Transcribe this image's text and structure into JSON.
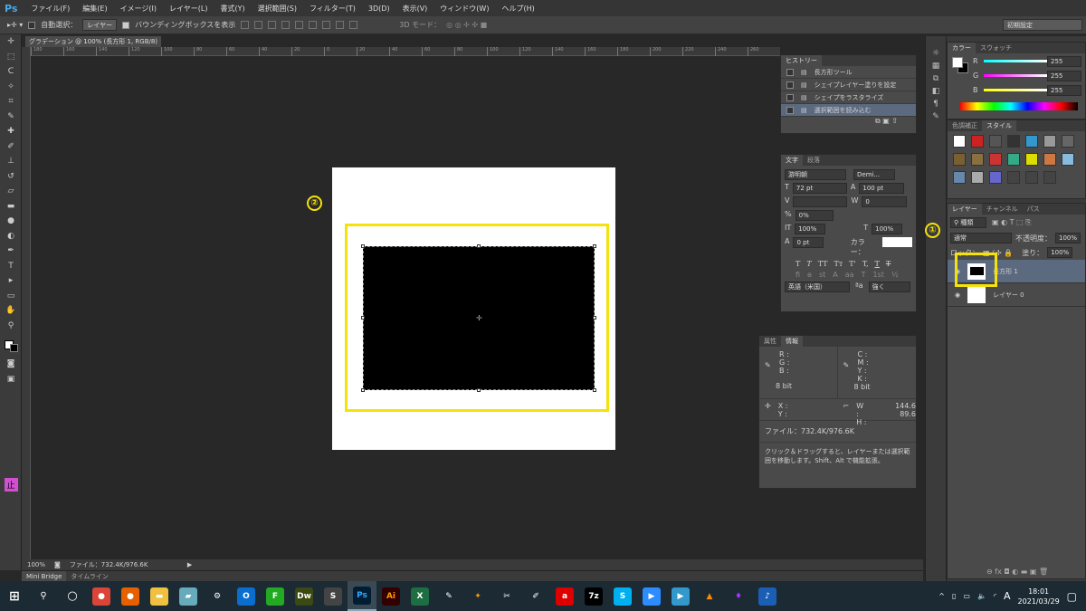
{
  "app": {
    "logo": "Ps",
    "workspace": "初期設定"
  },
  "menu": [
    "ファイル(F)",
    "編集(E)",
    "イメージ(I)",
    "レイヤー(L)",
    "書式(Y)",
    "選択範囲(S)",
    "フィルター(T)",
    "3D(D)",
    "表示(V)",
    "ウィンドウ(W)",
    "ヘルプ(H)"
  ],
  "options": {
    "auto_select": "自動選択：",
    "target": "レイヤー",
    "bounding_box": "バウンディングボックスを表示",
    "mode3d": "3D モード："
  },
  "document": {
    "tab_title": "グラデーション @ 100% (長方形 1, RGB/8) *",
    "ruler_ticks": [
      "180",
      "160",
      "140",
      "120",
      "100",
      "80",
      "60",
      "40",
      "20",
      "0",
      "20",
      "40",
      "60",
      "80",
      "100",
      "120",
      "140",
      "160",
      "180",
      "200",
      "220",
      "240",
      "260"
    ]
  },
  "annotations": {
    "one": "①",
    "two": "②",
    "color": "#f5e20a"
  },
  "history": {
    "tab": "ヒストリー",
    "items": [
      "長方形ツール",
      "シェイプレイヤー塗りを設定",
      "シェイプをラスタライズ",
      "選択範囲を読み込む"
    ],
    "selected": 3
  },
  "character": {
    "tabs": [
      "文字",
      "段落"
    ],
    "font": "游明朝",
    "style": "Demi...",
    "size": "72 pt",
    "leading": "100 pt",
    "kerning": "",
    "tracking": "0",
    "tsume": "0%",
    "vscale": "100%",
    "hscale": "100%",
    "baseline": "0 pt",
    "color_label": "カラー：",
    "language": "英語（米国）",
    "antialias": "強く",
    "aa_label": "ªa"
  },
  "info": {
    "tabs": [
      "属性",
      "情報"
    ],
    "rgb": [
      "R :",
      "G :",
      "B :"
    ],
    "cmyk": [
      "C :",
      "M :",
      "Y :",
      "K :"
    ],
    "bit_left": "8 bit",
    "bit_right": "8 bit",
    "xy": [
      "X :",
      "Y :"
    ],
    "w_label": "W :",
    "h_label": "H :",
    "w": "144.6",
    "h": "89.6",
    "file": "ファイル：732.4K/976.6K",
    "hint": "クリック＆ドラッグすると、レイヤーまたは選択範囲を移動します。Shift、Alt で機能拡張。"
  },
  "color": {
    "tabs": [
      "カラー",
      "スウォッチ"
    ],
    "r": "255",
    "g": "255",
    "b": "255",
    "labels": [
      "R",
      "G",
      "B"
    ]
  },
  "styles": {
    "tabs": [
      "色調補正",
      "スタイル"
    ]
  },
  "layers": {
    "tabs": [
      "レイヤー",
      "チャンネル",
      "パス"
    ],
    "filter": "種類",
    "blend": "通常",
    "opacity_label": "不透明度：",
    "opacity": "100%",
    "lock_label": "ロック：",
    "fill_label": "塗り：",
    "fill": "100%",
    "items": [
      {
        "name": "長方形 1",
        "selected": true
      },
      {
        "name": "レイヤー 0",
        "selected": false
      }
    ]
  },
  "status": {
    "zoom": "100%",
    "file": "ファイル：732.4K/976.6K"
  },
  "bottom_tabs": [
    "Mini Bridge",
    "タイムライン"
  ],
  "taskbar": {
    "apps": [
      "Chrome",
      "Firefox",
      "Explorer",
      "Notes",
      "Settings",
      "Outlook",
      "FTP",
      "Dw",
      "Sublime",
      "Ps",
      "Ai",
      "X",
      "Tool",
      "Butterfly",
      "Paint",
      "Palette",
      "Acrobat",
      "7z",
      "S",
      "Zoom",
      "Player",
      "VLC",
      "Purple",
      "Music"
    ],
    "ime": "A",
    "time": "18:01",
    "date": "2021/03/29"
  }
}
